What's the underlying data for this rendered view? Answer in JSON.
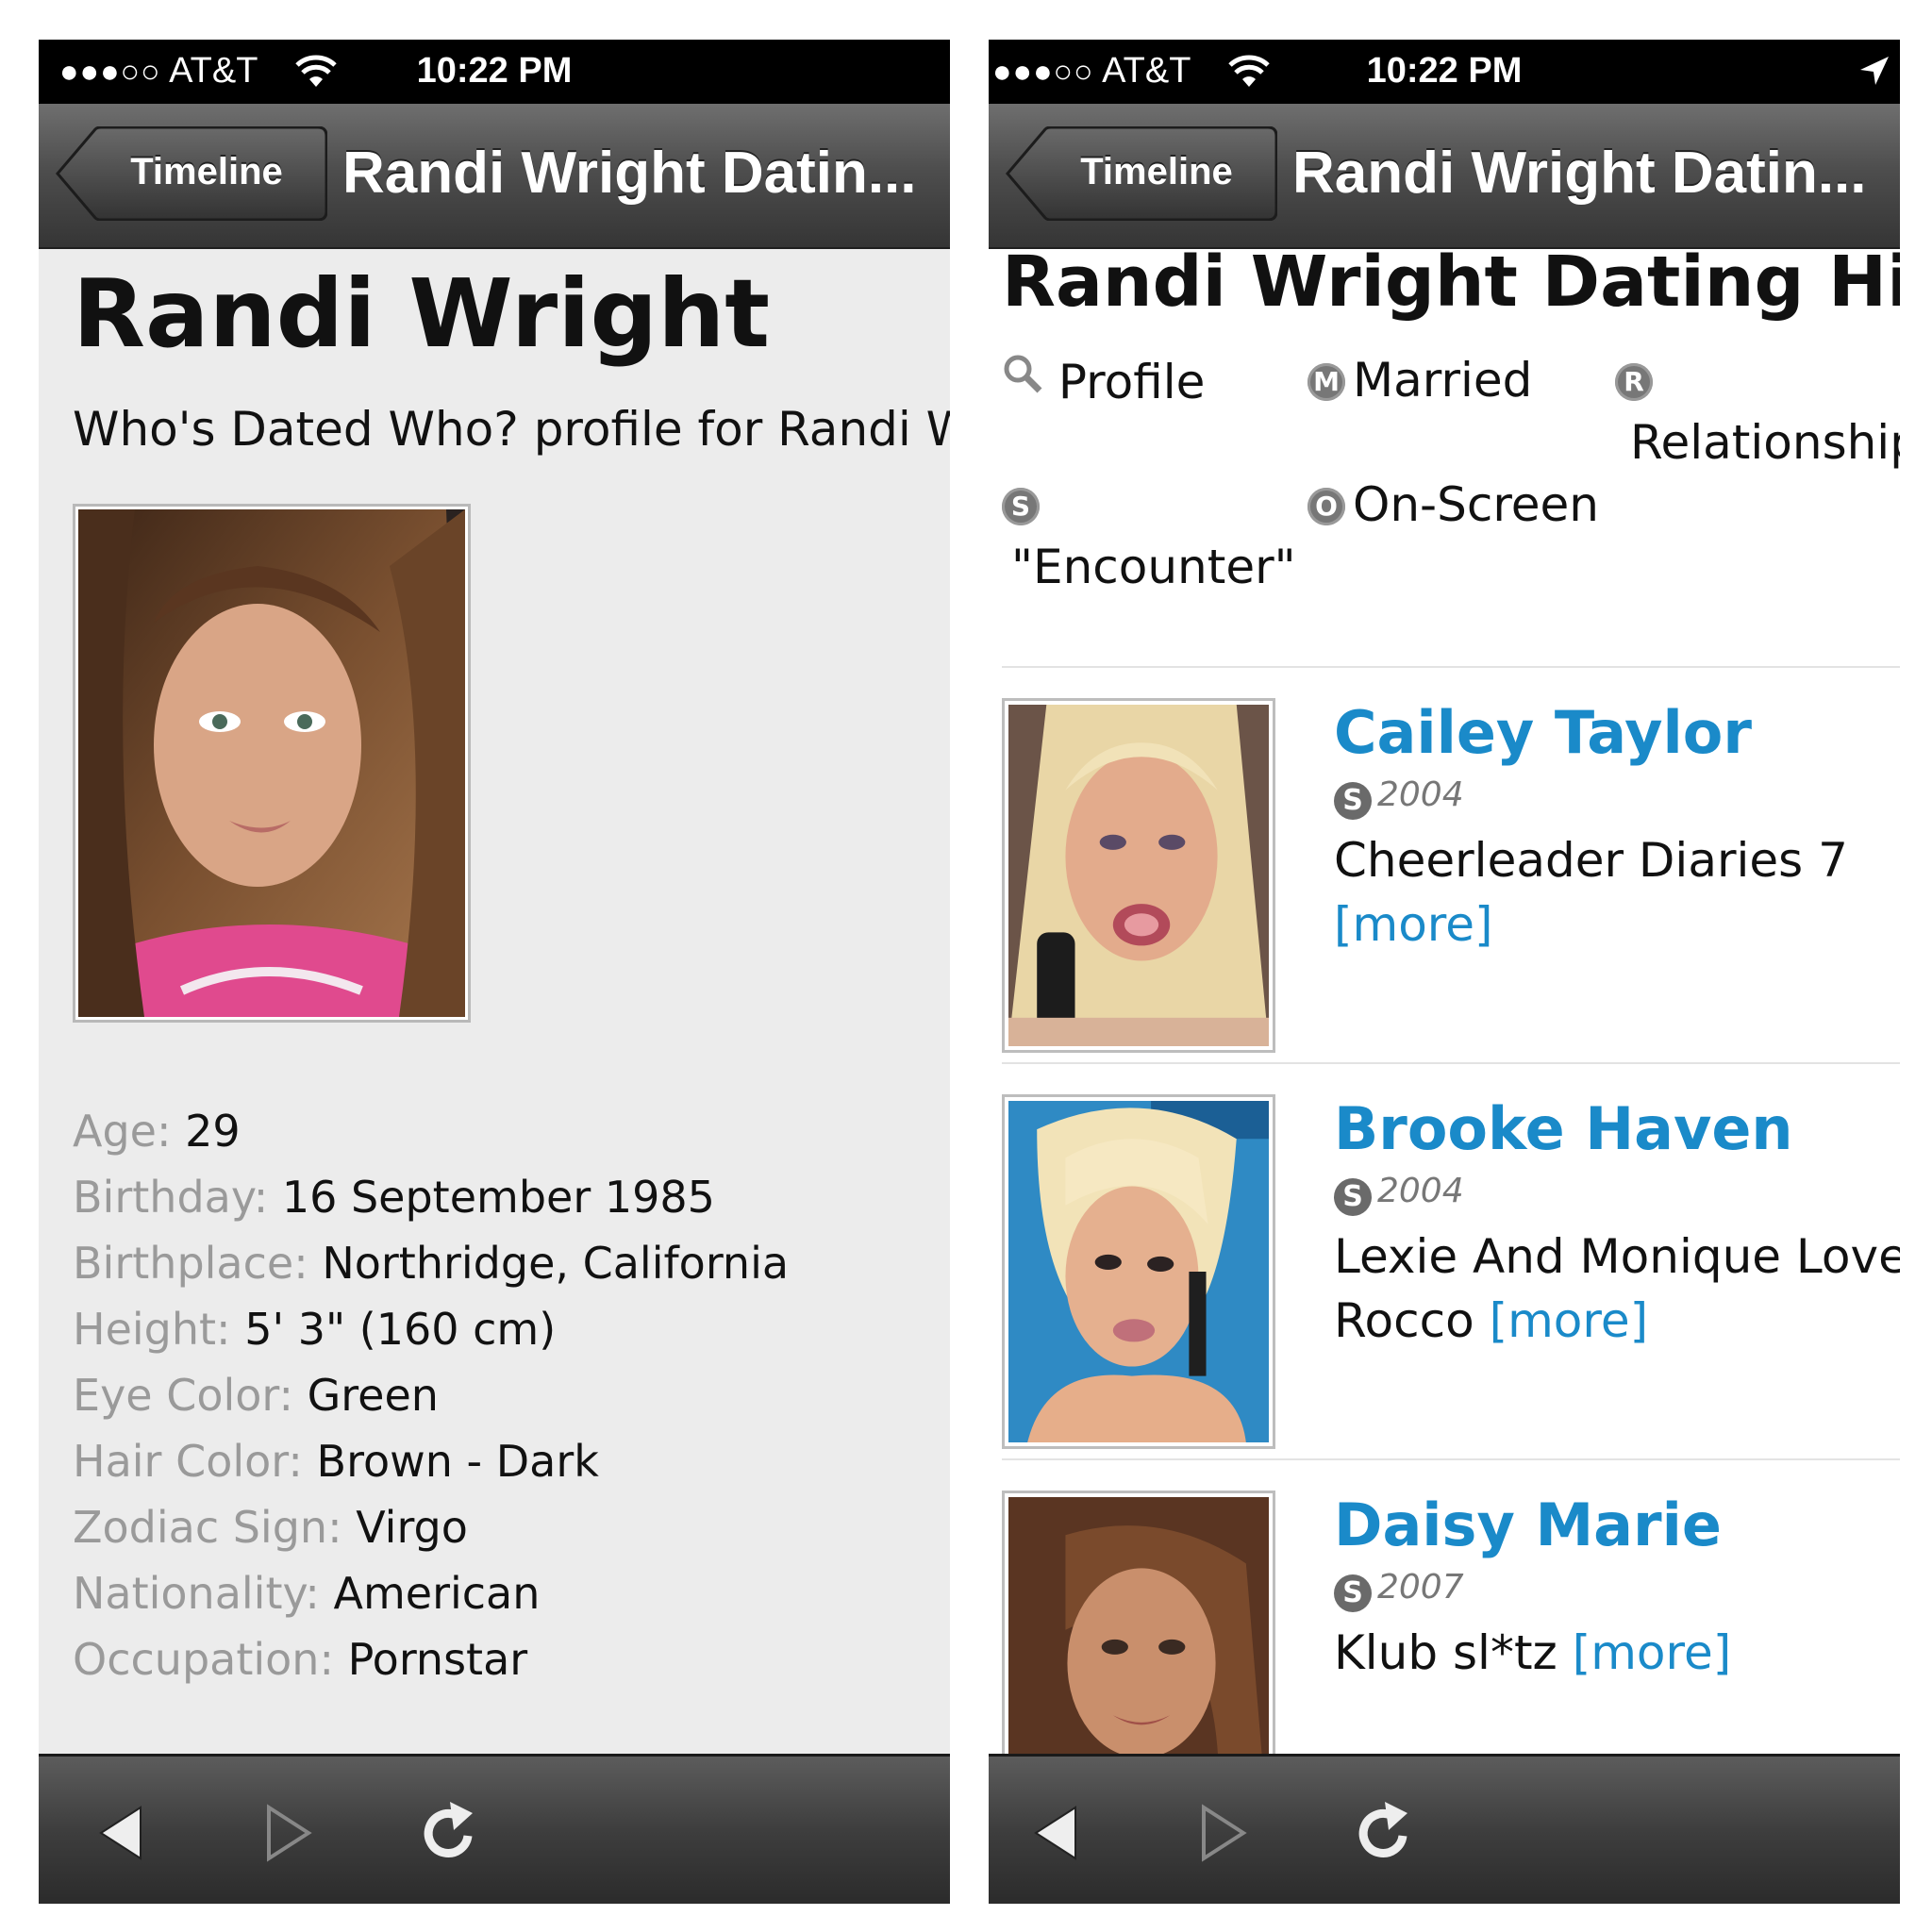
{
  "status_bar": {
    "carrier": "AT&T",
    "signal_dots": "●●●○○",
    "time": "10:22 PM"
  },
  "nav": {
    "back_label": "Timeline",
    "title": "Randi Wright Datin..."
  },
  "profile": {
    "name": "Randi Wright",
    "description": "Who's Dated Who? profile for Randi Wright",
    "facts": [
      {
        "label": "Age:",
        "value": "29"
      },
      {
        "label": "Birthday:",
        "value": "16 September 1985"
      },
      {
        "label": "Birthplace:",
        "value": "Northridge, California"
      },
      {
        "label": "Height:",
        "value": "5' 3\" (160 cm)"
      },
      {
        "label": "Eye Color:",
        "value": "Green"
      },
      {
        "label": "Hair Color:",
        "value": "Brown - Dark"
      },
      {
        "label": "Zodiac Sign:",
        "value": "Virgo"
      },
      {
        "label": "Nationality:",
        "value": "American"
      },
      {
        "label": "Occupation:",
        "value": "Pornstar"
      }
    ]
  },
  "history": {
    "title": "Randi Wright Dating History",
    "legend": {
      "profile": "Profile",
      "married": "Married",
      "relationship": "Relationship",
      "encounter": "\"Encounter\"",
      "onscreen": "On-Screen",
      "icon_m": "M",
      "icon_r": "R",
      "icon_s": "S",
      "icon_o": "O"
    },
    "entries": [
      {
        "name": "Cailey Taylor",
        "type_icon": "S",
        "year": "2004",
        "film": "Cheerleader Diaries 7",
        "more": "[more]"
      },
      {
        "name": "Brooke Haven",
        "type_icon": "S",
        "year": "2004",
        "film": "Lexie And Monique Love Rocco",
        "more": "[more]"
      },
      {
        "name": "Daisy Marie",
        "type_icon": "S",
        "year": "2007",
        "film": "Klub sl*tz",
        "more": "[more]"
      }
    ]
  },
  "colors": {
    "link": "#1a8ac9",
    "label_gray": "#9a9a9a",
    "content_bg": "#ececec"
  }
}
